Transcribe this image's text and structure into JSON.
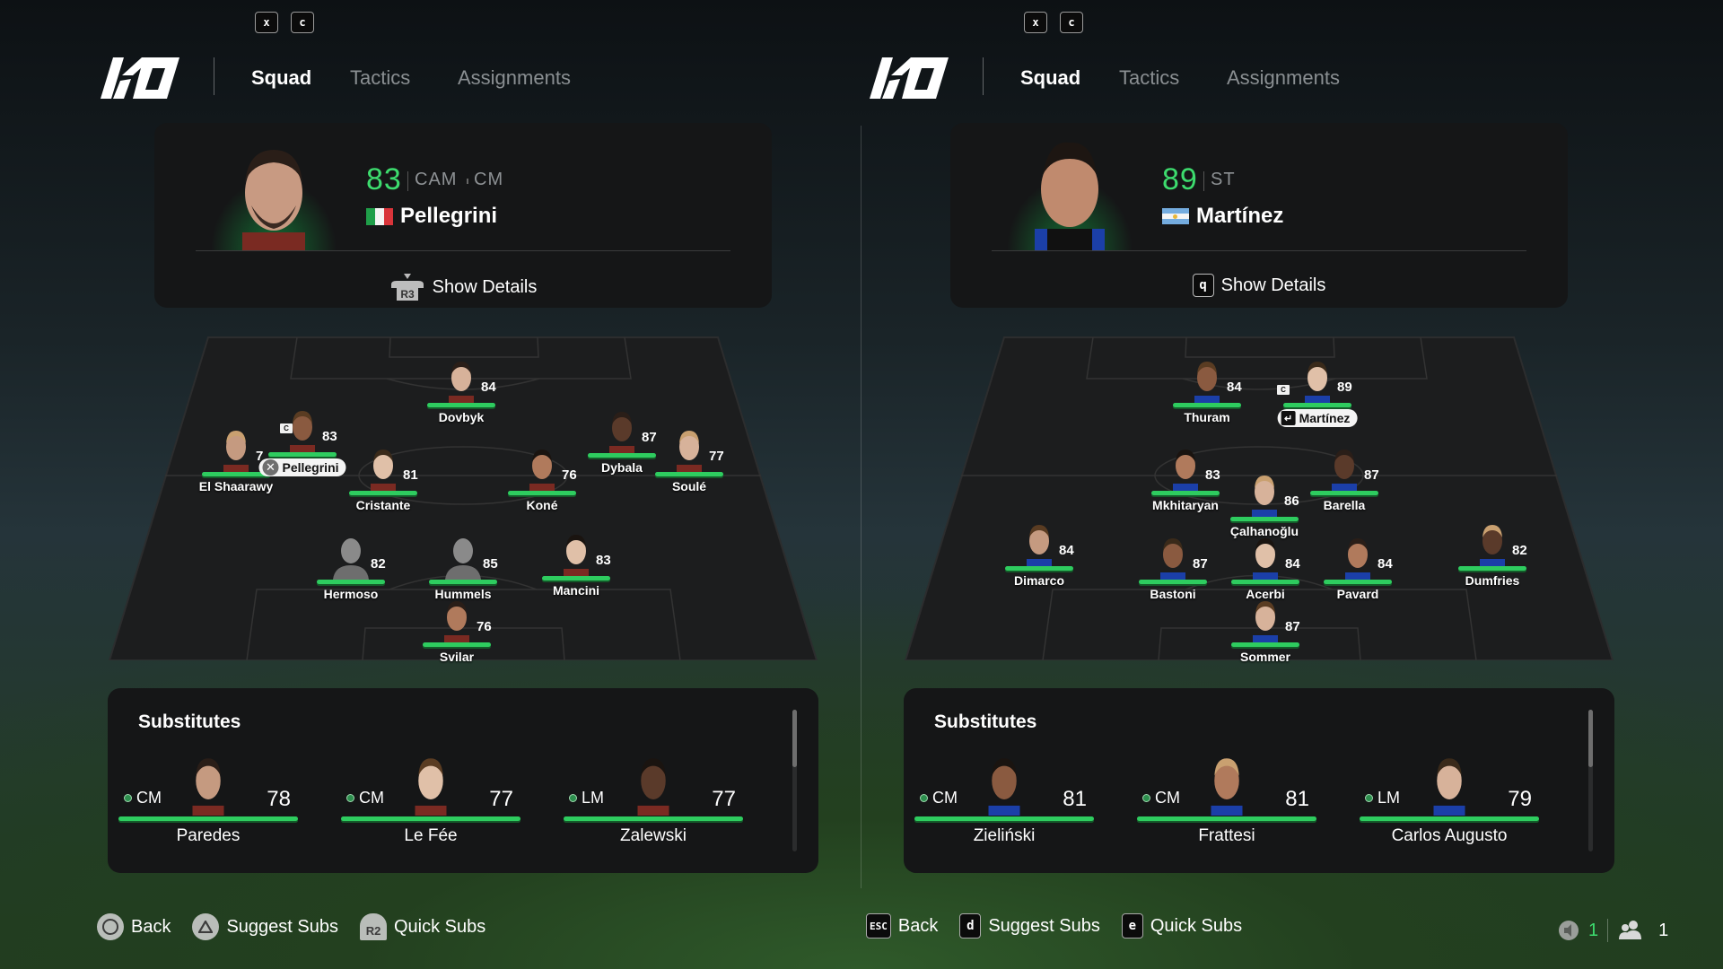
{
  "colors": {
    "accent_green": "#3ddc6e",
    "bar_green": "#2ecc5f",
    "panel_bg": "#151617"
  },
  "teams": [
    {
      "side": "left",
      "key_prompts": [
        "x",
        "c"
      ],
      "logo_icon": "ko-logo-icon",
      "tabs": [
        {
          "label": "Squad",
          "active": true
        },
        {
          "label": "Tactics",
          "active": false
        },
        {
          "label": "Assignments",
          "active": false
        }
      ],
      "selected_player": {
        "rating": "83",
        "positions": [
          "CAM",
          "CM"
        ],
        "name": "Pellegrini",
        "nationality_flag": "italy-flag-icon",
        "show_details_label": "Show Details",
        "show_details_button_icon": "r3-stick-icon"
      },
      "lineup": [
        {
          "name": "Dovbyk",
          "rating": "84"
        },
        {
          "name": "El Shaarawy",
          "rating": "7"
        },
        {
          "name": "Pellegrini",
          "rating": "83",
          "captain": true,
          "selected": true
        },
        {
          "name": "Cristante",
          "rating": "81"
        },
        {
          "name": "Koné",
          "rating": "76"
        },
        {
          "name": "Dybala",
          "rating": "87"
        },
        {
          "name": "Soulé",
          "rating": "77"
        },
        {
          "name": "Hermoso",
          "rating": "82",
          "placeholder_face": true
        },
        {
          "name": "Hummels",
          "rating": "85",
          "placeholder_face": true
        },
        {
          "name": "Mancini",
          "rating": "83"
        },
        {
          "name": "Svilar",
          "rating": "76"
        }
      ],
      "substitutes": {
        "title": "Substitutes",
        "items": [
          {
            "position": "CM",
            "rating": "78",
            "name": "Paredes"
          },
          {
            "position": "CM",
            "rating": "77",
            "name": "Le Fée"
          },
          {
            "position": "LM",
            "rating": "77",
            "name": "Zalewski"
          }
        ]
      },
      "bottom_hints": [
        {
          "icon": "circle-button-icon",
          "label": "Back"
        },
        {
          "icon": "triangle-button-icon",
          "label": "Suggest Subs"
        },
        {
          "icon": "r2-button-icon",
          "key": "R2",
          "label": "Quick Subs"
        }
      ]
    },
    {
      "side": "right",
      "key_prompts": [
        "x",
        "c"
      ],
      "logo_icon": "ko-logo-icon",
      "tabs": [
        {
          "label": "Squad",
          "active": true
        },
        {
          "label": "Tactics",
          "active": false
        },
        {
          "label": "Assignments",
          "active": false
        }
      ],
      "selected_player": {
        "rating": "89",
        "positions": [
          "ST"
        ],
        "name": "Martínez",
        "nationality_flag": "argentina-flag-icon",
        "show_details_label": "Show Details",
        "show_details_key": "q"
      },
      "lineup": [
        {
          "name": "Thuram",
          "rating": "84"
        },
        {
          "name": "Martínez",
          "rating": "89",
          "captain": true,
          "selected": true
        },
        {
          "name": "Mkhitaryan",
          "rating": "83"
        },
        {
          "name": "Barella",
          "rating": "87"
        },
        {
          "name": "Çalhanoğlu",
          "rating": "86"
        },
        {
          "name": "Dimarco",
          "rating": "84"
        },
        {
          "name": "Bastoni",
          "rating": "87"
        },
        {
          "name": "Acerbi",
          "rating": "84"
        },
        {
          "name": "Pavard",
          "rating": "84"
        },
        {
          "name": "Dumfries",
          "rating": "82"
        },
        {
          "name": "Sommer",
          "rating": "87"
        }
      ],
      "substitutes": {
        "title": "Substitutes",
        "items": [
          {
            "position": "CM",
            "rating": "81",
            "name": "Zieliński"
          },
          {
            "position": "CM",
            "rating": "81",
            "name": "Frattesi"
          },
          {
            "position": "LM",
            "rating": "79",
            "name": "Carlos Augusto"
          }
        ]
      },
      "bottom_hints": [
        {
          "key": "ESC",
          "label": "Back"
        },
        {
          "key": "d",
          "label": "Suggest Subs"
        },
        {
          "key": "e",
          "label": "Quick Subs"
        }
      ]
    }
  ],
  "status": {
    "voice_count": "1",
    "players_count": "1"
  }
}
